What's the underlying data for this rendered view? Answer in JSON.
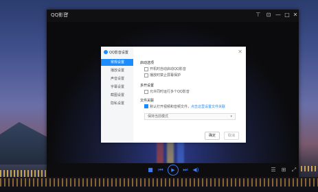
{
  "player": {
    "app_title": "QQ影音",
    "title_caret": "▾",
    "controls": {
      "pin": "⊤",
      "skin": "⊡",
      "minimize": "—",
      "maximize": "□",
      "close": "✕"
    },
    "playback": {
      "stop": "■",
      "prev": "⏮",
      "play": "▶",
      "next": "⏭",
      "volume": "◀)",
      "playlist": "☰",
      "mode": "⊞",
      "fullscreen": "⤢"
    }
  },
  "dialog": {
    "title": "QQ影音设置",
    "close": "✕",
    "nav": [
      "常规设置",
      "播放设置",
      "声音设置",
      "字幕设置",
      "截图设置",
      "隐私设置"
    ],
    "active_nav_index": 0,
    "section_startup": "启动选项",
    "opt1": "开机时自动启动QQ影音",
    "opt2": "播放时禁止屏幕保护",
    "section_multi": "多开设置",
    "opt3": "允许同时运行多个QQ影音",
    "section_assoc": "文件关联",
    "assoc_text": "默认打开视频和音频文件，",
    "assoc_link": "点击这里设置文件关联",
    "select_value": "保持当前模式",
    "select_caret": "▾",
    "ok": "确定",
    "cancel": "取消"
  },
  "colors": {
    "accent": "#1a8cff",
    "player_bg": "#0b0b0d"
  }
}
